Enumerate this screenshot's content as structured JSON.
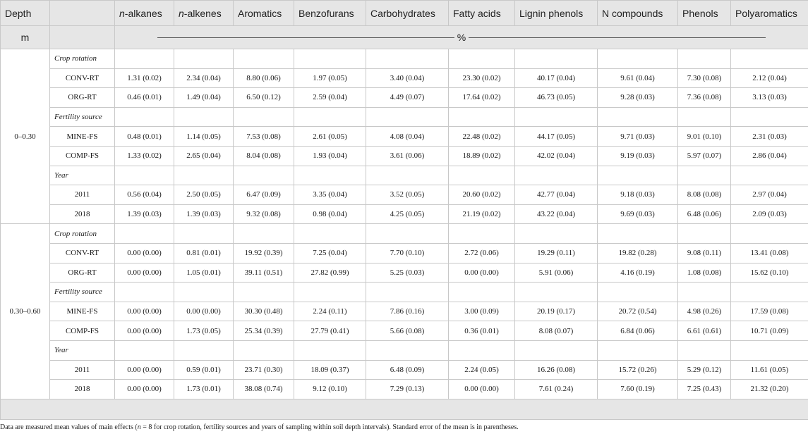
{
  "header": {
    "depth_label": "Depth",
    "unit_depth": "m",
    "unit_pct": "%",
    "columns": [
      {
        "prefix": "n",
        "text": "-alkanes"
      },
      {
        "prefix": "n",
        "text": "-alkenes"
      },
      {
        "prefix": "",
        "text": "Aromatics"
      },
      {
        "prefix": "",
        "text": "Benzofurans"
      },
      {
        "prefix": "",
        "text": "Carbohydrates"
      },
      {
        "prefix": "",
        "text": "Fatty acids"
      },
      {
        "prefix": "",
        "text": "Lignin phenols"
      },
      {
        "prefix": "",
        "text": "N compounds"
      },
      {
        "prefix": "",
        "text": "Phenols"
      },
      {
        "prefix": "",
        "text": "Polyaromatics"
      }
    ]
  },
  "sections": [
    {
      "depth": "0–0.30",
      "groups": [
        {
          "name": "Crop rotation",
          "rows": [
            {
              "label": "CONV-RT",
              "values": [
                "1.31 (0.02)",
                "2.34 (0.04)",
                "8.80 (0.06)",
                "1.97 (0.05)",
                "3.40 (0.04)",
                "23.30 (0.02)",
                "40.17 (0.04)",
                "9.61 (0.04)",
                "7.30 (0.08)",
                "2.12 (0.04)"
              ]
            },
            {
              "label": "ORG-RT",
              "values": [
                "0.46 (0.01)",
                "1.49 (0.04)",
                "6.50 (0.12)",
                "2.59 (0.04)",
                "4.49 (0.07)",
                "17.64 (0.02)",
                "46.73 (0.05)",
                "9.28 (0.03)",
                "7.36 (0.08)",
                "3.13 (0.03)"
              ]
            }
          ]
        },
        {
          "name": "Fertility source",
          "rows": [
            {
              "label": "MINE-FS",
              "values": [
                "0.48 (0.01)",
                "1.14 (0.05)",
                "7.53 (0.08)",
                "2.61 (0.05)",
                "4.08 (0.04)",
                "22.48 (0.02)",
                "44.17 (0.05)",
                "9.71 (0.03)",
                "9.01 (0.10)",
                "2.31 (0.03)"
              ]
            },
            {
              "label": "COMP-FS",
              "values": [
                "1.33 (0.02)",
                "2.65 (0.04)",
                "8.04 (0.08)",
                "1.93 (0.04)",
                "3.61 (0.06)",
                "18.89 (0.02)",
                "42.02 (0.04)",
                "9.19 (0.03)",
                "5.97 (0.07)",
                "2.86 (0.04)"
              ]
            }
          ]
        },
        {
          "name": "Year",
          "rows": [
            {
              "label": "2011",
              "values": [
                "0.56 (0.04)",
                "2.50 (0.05)",
                "6.47 (0.09)",
                "3.35 (0.04)",
                "3.52 (0.05)",
                "20.60 (0.02)",
                "42.77 (0.04)",
                "9.18 (0.03)",
                "8.08 (0.08)",
                "2.97 (0.04)"
              ]
            },
            {
              "label": "2018",
              "values": [
                "1.39 (0.03)",
                "1.39 (0.03)",
                "9.32 (0.08)",
                "0.98 (0.04)",
                "4.25 (0.05)",
                "21.19 (0.02)",
                "43.22 (0.04)",
                "9.69 (0.03)",
                "6.48 (0.06)",
                "2.09 (0.03)"
              ]
            }
          ]
        }
      ]
    },
    {
      "depth": "0.30–0.60",
      "groups": [
        {
          "name": "Crop rotation",
          "rows": [
            {
              "label": "CONV-RT",
              "values": [
                "0.00 (0.00)",
                "0.81 (0.01)",
                "19.92 (0.39)",
                "7.25 (0.04)",
                "7.70 (0.10)",
                "2.72 (0.06)",
                "19.29 (0.11)",
                "19.82 (0.28)",
                "9.08 (0.11)",
                "13.41 (0.08)"
              ]
            },
            {
              "label": "ORG-RT",
              "values": [
                "0.00 (0.00)",
                "1.05 (0.01)",
                "39.11 (0.51)",
                "27.82 (0.99)",
                "5.25 (0.03)",
                "0.00 (0.00)",
                "5.91 (0.06)",
                "4.16 (0.19)",
                "1.08 (0.08)",
                "15.62 (0.10)"
              ]
            }
          ]
        },
        {
          "name": "Fertility source",
          "rows": [
            {
              "label": "MINE-FS",
              "values": [
                "0.00 (0.00)",
                "0.00 (0.00)",
                "30.30 (0.48)",
                "2.24 (0.11)",
                "7.86 (0.16)",
                "3.00 (0.09)",
                "20.19 (0.17)",
                "20.72 (0.54)",
                "4.98 (0.26)",
                "17.59 (0.08)"
              ]
            },
            {
              "label": "COMP-FS",
              "values": [
                "0.00 (0.00)",
                "1.73 (0.05)",
                "25.34 (0.39)",
                "27.79 (0.41)",
                "5.66 (0.08)",
                "0.36 (0.01)",
                "8.08 (0.07)",
                "6.84 (0.06)",
                "6.61 (0.61)",
                "10.71 (0.09)"
              ]
            }
          ]
        },
        {
          "name": "Year",
          "rows": [
            {
              "label": "2011",
              "values": [
                "0.00 (0.00)",
                "0.59 (0.01)",
                "23.71 (0.30)",
                "18.09 (0.37)",
                "6.48 (0.09)",
                "2.24 (0.05)",
                "16.26 (0.08)",
                "15.72 (0.26)",
                "5.29 (0.12)",
                "11.61 (0.05)"
              ]
            },
            {
              "label": "2018",
              "values": [
                "0.00 (0.00)",
                "1.73 (0.01)",
                "38.08 (0.74)",
                "9.12 (0.10)",
                "7.29 (0.13)",
                "0.00 (0.00)",
                "7.61 (0.24)",
                "7.60 (0.19)",
                "7.25 (0.43)",
                "21.32 (0.20)"
              ]
            }
          ]
        }
      ]
    }
  ],
  "footnote": {
    "before": "Data are measured mean values of main effects (",
    "n_symbol": "n",
    "after": " = 8 for crop rotation, fertility sources and years of sampling within soil depth intervals). Standard error of the mean is in parentheses."
  },
  "colors": {
    "header_bg": "#e6e6e6",
    "border": "#c8c8c8",
    "text": "#1a1a1a"
  }
}
